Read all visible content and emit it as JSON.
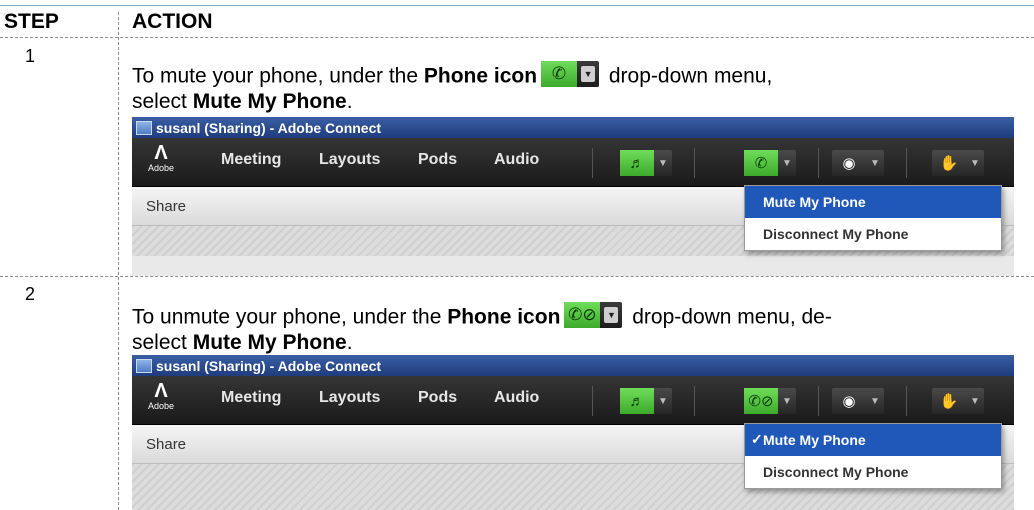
{
  "header": {
    "step": "STEP",
    "action": "ACTION"
  },
  "rows": [
    {
      "step": "1",
      "instruction": {
        "pre": "To mute your phone, under the ",
        "bold1": "Phone icon",
        "mid": " drop-down menu,",
        "pre2": "select ",
        "bold2": "Mute My Phone",
        "post": "."
      },
      "app": {
        "window_title": "susanl (Sharing) - Adobe Connect",
        "logo_text": "Adobe",
        "menu": [
          "Meeting",
          "Layouts",
          "Pods",
          "Audio"
        ],
        "share_label": "Share",
        "phone_icon": "phone-icon",
        "dropdown": [
          {
            "label": "Mute My Phone",
            "selected": true,
            "checked": false
          },
          {
            "label": "Disconnect My Phone",
            "selected": false,
            "checked": false
          }
        ]
      }
    },
    {
      "step": "2",
      "instruction": {
        "pre": "To unmute your phone, under the ",
        "bold1": "Phone icon",
        "mid": " drop-down menu, de-",
        "pre2": "select ",
        "bold2": "Mute My Phone",
        "post": "."
      },
      "app": {
        "window_title": "susanl (Sharing) - Adobe Connect",
        "logo_text": "Adobe",
        "menu": [
          "Meeting",
          "Layouts",
          "Pods",
          "Audio"
        ],
        "share_label": "Share",
        "phone_icon": "phone-muted-icon",
        "dropdown": [
          {
            "label": "Mute My Phone",
            "selected": true,
            "checked": true
          },
          {
            "label": "Disconnect My Phone",
            "selected": false,
            "checked": false
          }
        ]
      }
    }
  ],
  "colors": {
    "menu_highlight": "#1f58b9",
    "title_bar": "#1f3c7c",
    "phone_green": "#3eaa2c"
  }
}
